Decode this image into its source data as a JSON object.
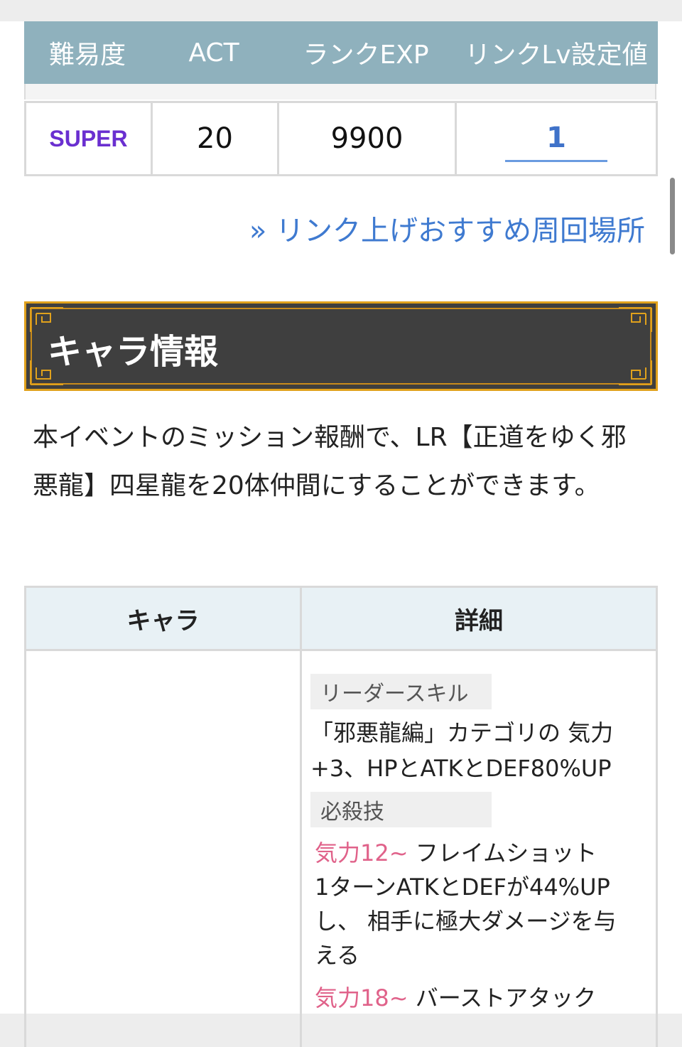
{
  "stage_table": {
    "headers": [
      "難易度",
      "ACT",
      "ランクEXP",
      "リンクLv設定値"
    ],
    "row": {
      "difficulty": "SUPER",
      "act": "20",
      "rank_exp": "9900",
      "link_lv": "1"
    }
  },
  "recommend_link": "» リンク上げおすすめ周回場所",
  "section": {
    "title": "キャラ情報"
  },
  "intro": "本イベントのミッション報酬で、LR【正道をゆく邪悪龍】四星龍を20体仲間にすることができます。",
  "char_table": {
    "headers": [
      "キャラ",
      "詳細"
    ],
    "leader_skill_label": "リーダースキル",
    "leader_skill_text": "「邪悪龍編」カテゴリの 気力+3、HPとATKとDEF80%UP",
    "special_label": "必殺技",
    "special_1_ki": "気力12~",
    "special_1_name": "フレイムショット",
    "special_1_desc": "1ターンATKとDEFが44%UPし、 相手に極大ダメージを与える",
    "special_2_ki": "気力18~",
    "special_2_name": "バーストアタック"
  },
  "colors": {
    "header_bg": "#8fb1bd",
    "super": "#6a2fd0",
    "link": "#3f7ad0",
    "section_bg": "#3f3f3f",
    "section_border": "#e0a11c",
    "ki": "#e0628a"
  }
}
